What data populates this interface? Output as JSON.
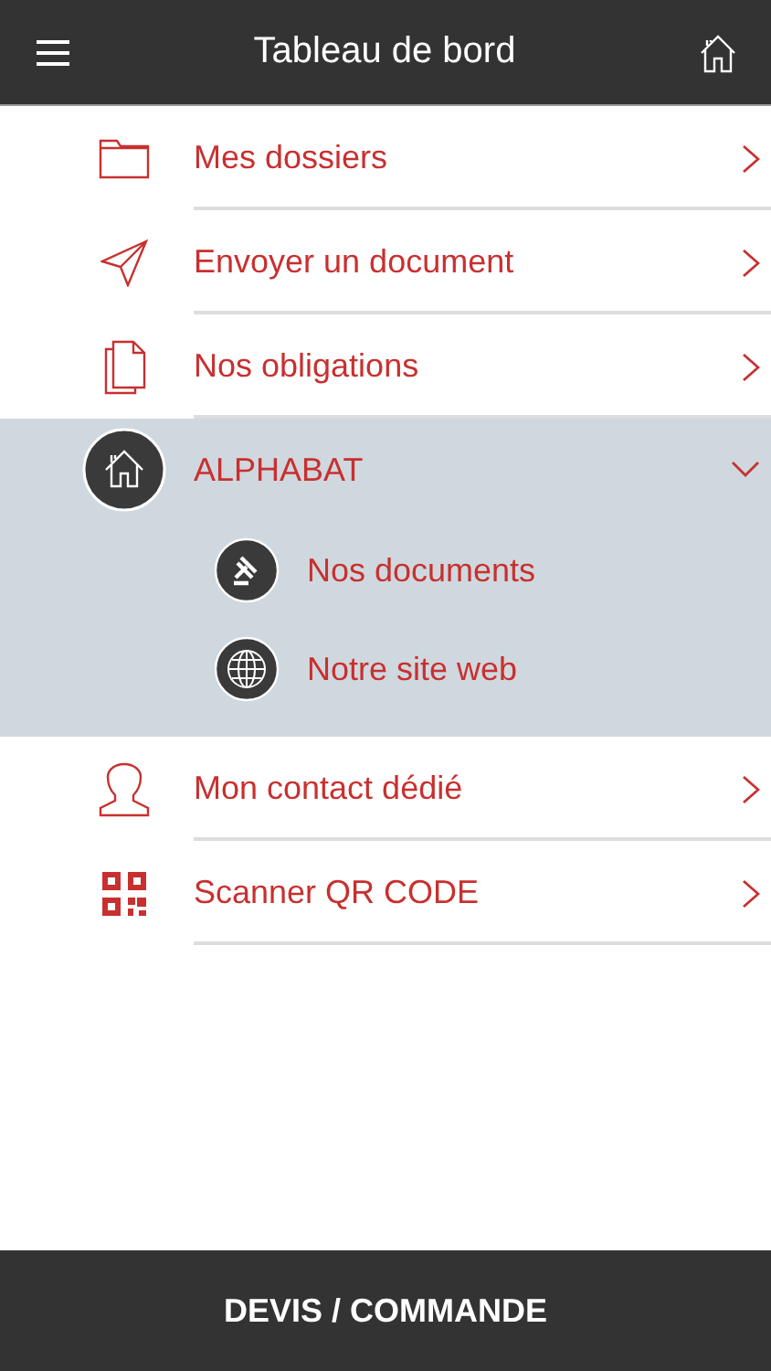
{
  "header": {
    "title": "Tableau de bord"
  },
  "menu": [
    {
      "kind": "link",
      "label": "Mes dossiers"
    },
    {
      "kind": "link",
      "label": "Envoyer un document"
    },
    {
      "kind": "link",
      "label": "Nos obligations"
    },
    {
      "kind": "group",
      "label": "ALPHABAT",
      "expanded": true,
      "children": [
        {
          "label": "Nos documents"
        },
        {
          "label": "Notre site web"
        }
      ]
    },
    {
      "kind": "link",
      "label": "Mon contact dédié"
    },
    {
      "kind": "link",
      "label": "Scanner QR CODE"
    }
  ],
  "footer_button": "DEVIS / COMMANDE"
}
